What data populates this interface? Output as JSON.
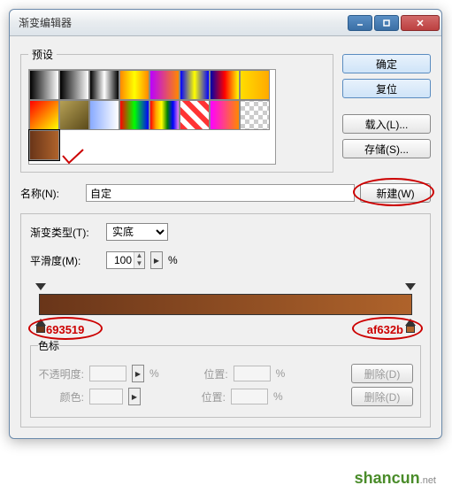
{
  "window": {
    "title": "渐变编辑器"
  },
  "presets": {
    "legend": "预设",
    "selected_index": 16
  },
  "buttons": {
    "ok": "确定",
    "reset": "复位",
    "load": "载入(L)...",
    "save": "存储(S)...",
    "new": "新建(W)",
    "delete": "删除(D)"
  },
  "name": {
    "label": "名称(N):",
    "value": "自定"
  },
  "gradient": {
    "type_label": "渐变类型(T):",
    "type_value": "实底",
    "smooth_label": "平滑度(M):",
    "smooth_value": "100",
    "smooth_unit": "%",
    "start_color": "#693519",
    "end_color": "#af632b",
    "start_hex": "693519",
    "end_hex": "af632b"
  },
  "stops": {
    "legend": "色标",
    "opacity_label": "不透明度:",
    "color_label": "颜色:",
    "position_label": "位置:",
    "pct": "%"
  },
  "watermark": {
    "brand": "shancun",
    "tld": ".net"
  }
}
